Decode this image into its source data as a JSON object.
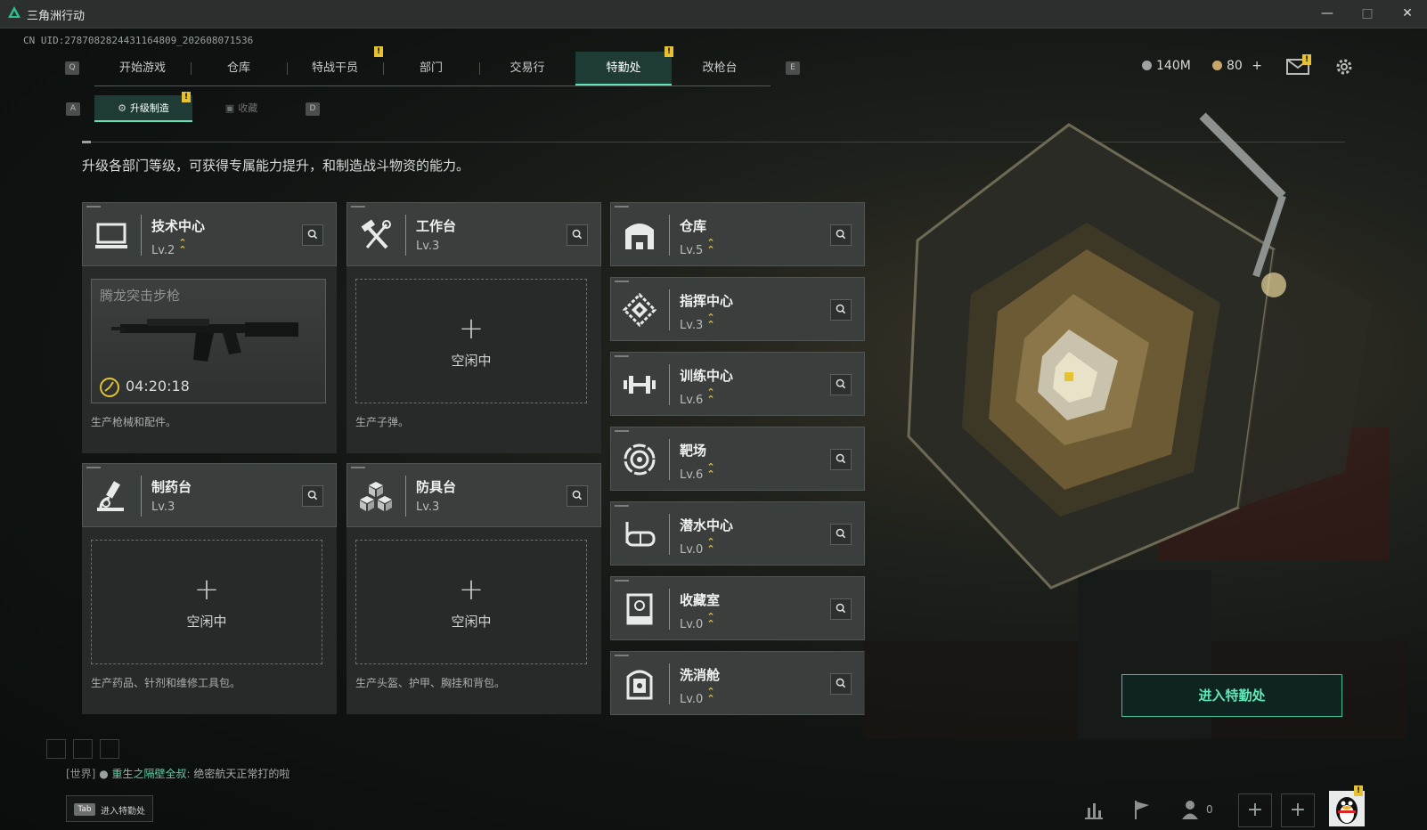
{
  "window": {
    "title": "三角洲行动"
  },
  "uid": "CN UID:2787082824431164809_202608071536",
  "nav": {
    "key_left": "Q",
    "key_right": "E",
    "tabs": [
      "开始游戏",
      "仓库",
      "特战干员",
      "部门",
      "交易行",
      "特勤处",
      "改枪台"
    ],
    "active": "特勤处"
  },
  "subnav": {
    "key_left": "A",
    "key_right": "D",
    "tabs": [
      "升级制造",
      "收藏"
    ],
    "active": "升级制造"
  },
  "resources": {
    "coins": "140M",
    "tickets": "80",
    "add": "+"
  },
  "description": "升级各部门等级，可获得专属能力提升，和制造战斗物资的能力。",
  "big_cards": [
    {
      "name": "技术中心",
      "level": "Lv.2",
      "icon": "monitor-icon",
      "upgradeable": true,
      "production": {
        "item": "腾龙突击步枪",
        "time": "04:20:18"
      },
      "desc": "生产枪械和配件。"
    },
    {
      "name": "工作台",
      "level": "Lv.3",
      "icon": "hammer-wrench-icon",
      "upgradeable": false,
      "slot": "空闲中",
      "desc": "生产子弹。"
    },
    {
      "name": "制药台",
      "level": "Lv.3",
      "icon": "microscope-icon",
      "upgradeable": false,
      "slot": "空闲中",
      "desc": "生产药品、针剂和维修工具包。"
    },
    {
      "name": "防具台",
      "level": "Lv.3",
      "icon": "boxes-icon",
      "upgradeable": false,
      "slot": "空闲中",
      "desc": "生产头盔、护甲、胸挂和背包。"
    }
  ],
  "small_cards": [
    {
      "name": "仓库",
      "level": "Lv.5",
      "icon": "warehouse-icon",
      "upgradeable": true
    },
    {
      "name": "指挥中心",
      "level": "Lv.3",
      "icon": "chip-icon",
      "upgradeable": true
    },
    {
      "name": "训练中心",
      "level": "Lv.6",
      "icon": "dumbbell-icon",
      "upgradeable": true
    },
    {
      "name": "靶场",
      "level": "Lv.6",
      "icon": "target-icon",
      "upgradeable": true
    },
    {
      "name": "潜水中心",
      "level": "Lv.0",
      "icon": "diving-mask-icon",
      "upgradeable": true
    },
    {
      "name": "收藏室",
      "level": "Lv.0",
      "icon": "display-case-icon",
      "upgradeable": true
    },
    {
      "name": "洗消舱",
      "level": "Lv.0",
      "icon": "decon-pod-icon",
      "upgradeable": true
    }
  ],
  "enter_button": "进入特勤处",
  "chat": {
    "channel": "[世界]",
    "user": "重生之隔壁全叔",
    "separator": ":",
    "message": "绝密航天正常打的啦"
  },
  "tab_hint": {
    "key": "Tab",
    "label": "进入特勤处"
  },
  "bottom": {
    "friends_count": "0",
    "plus": "+"
  },
  "colors": {
    "accent": "#5fe0b6",
    "notify": "#e6c232",
    "upgrade": "#e6c232"
  }
}
